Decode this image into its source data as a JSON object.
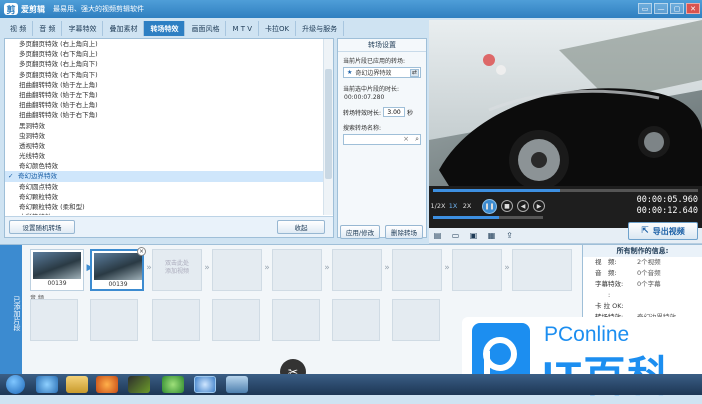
{
  "window": {
    "app_name": "爱剪辑",
    "slogan": "最易用、强大的视频剪辑软件",
    "logo_char": "剪",
    "controls": [
      "▭",
      "—",
      "▢",
      "✕"
    ]
  },
  "tabs": [
    "视 频",
    "音 频",
    "字幕特效",
    "叠加素材",
    "转场特效",
    "画面风格",
    "M T V",
    "卡拉OK",
    "升级与服务"
  ],
  "active_tab_index": 4,
  "transitions": [
    "多页翻页特效 (右上角向上)",
    "多页翻页特效 (右下角向上)",
    "多页翻页特效 (右上角向下)",
    "多页翻页特效 (右下角向下)",
    "扭曲翻转特效 (始于左上角)",
    "扭曲翻转特效 (始于左下角)",
    "扭曲翻转特效 (始于右上角)",
    "扭曲翻转特效 (始于右下角)",
    "黑洞特效",
    "虫洞特效",
    "透视特效",
    "光线特效",
    "奇幻颜色特效",
    "奇幻边界特效",
    "奇幻圆点特效",
    "奇幻颗粒特效",
    "奇幻颗粒特效 (柔和型)",
    "水彩笔特效",
    "奇幻阶梯特效"
  ],
  "selected_index": 13,
  "left_buttons": {
    "random": "设置随机转场",
    "collapse": "收起"
  },
  "settings": {
    "header": "转场设置",
    "applied_label": "当前片段已应用的转场:",
    "applied_value": "奇幻边界特效",
    "clip_time_label": "当前选中片段的时长:",
    "clip_time_value": "00:00:07.280",
    "duration_label": "转场特效时长:",
    "duration_value": "3.00",
    "duration_unit": "秒",
    "search_label": "搜索转场名称:",
    "search_value": "",
    "apply_btn": "应用/修改",
    "delete_btn": "删除转场"
  },
  "player": {
    "progress": 0.48,
    "speeds": [
      "1/2X",
      "1X",
      "2X"
    ],
    "time_current": "00:00:05.960",
    "time_total": "00:00:12.640",
    "export_label": "导出视频"
  },
  "timeline": {
    "side_label": "已添加片段",
    "clips": [
      {
        "caption": "00139"
      },
      {
        "caption": "00139"
      }
    ],
    "add_hint_1": "双击此处",
    "add_hint_2": "添加视频",
    "audio_label": "音 频"
  },
  "info": {
    "header": "所有制作的信息:",
    "rows": [
      {
        "k": "视　频:",
        "v": "2个视频"
      },
      {
        "k": "音　频:",
        "v": "0个音频"
      },
      {
        "k": "字幕特效:",
        "v": "0个字幕"
      },
      {
        "k": "　　:",
        "v": ""
      },
      {
        "k": "卡 拉 OK:",
        "v": ""
      },
      {
        "k": "转场特效:",
        "v": "奇幻边界特效"
      }
    ]
  },
  "watermark": {
    "top": "PConline",
    "main": "IT百科"
  }
}
